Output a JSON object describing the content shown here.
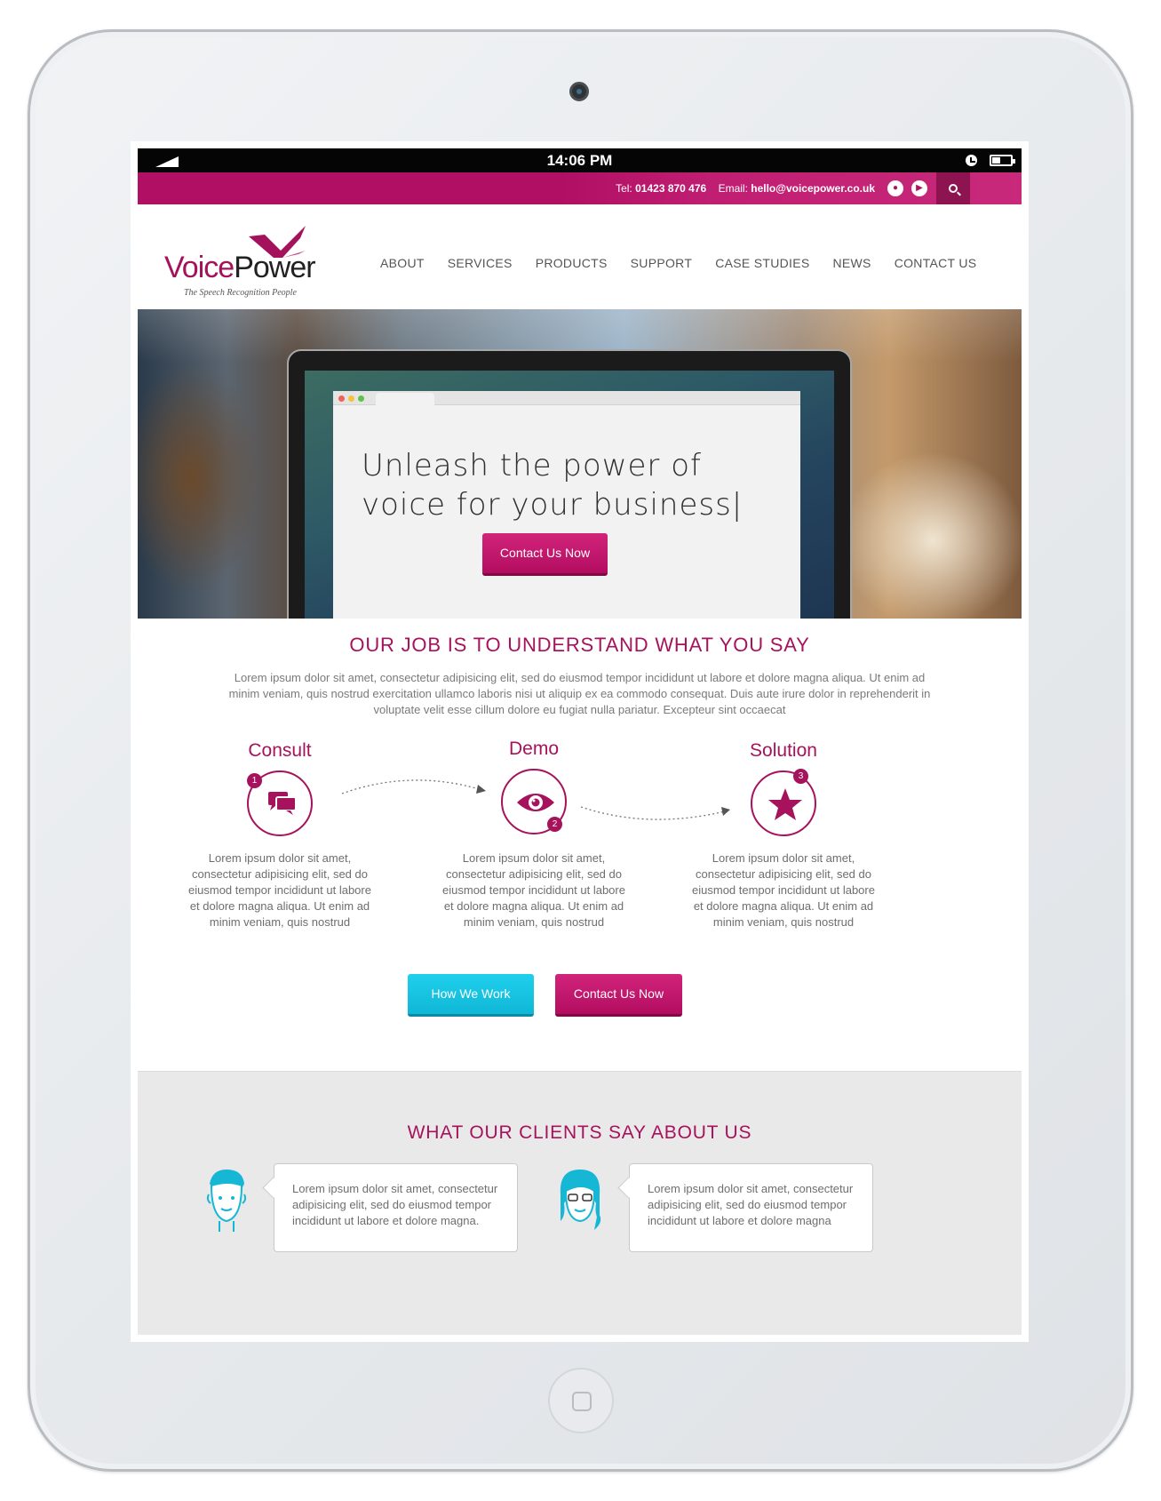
{
  "status_bar": {
    "time": "14:06 PM"
  },
  "top_bar": {
    "tel_label": "Tel:",
    "tel": "01423 870 476",
    "email_label": "Email:",
    "email": "hello@voicepower.co.uk"
  },
  "logo": {
    "brand_part1": "Voice",
    "brand_part2": "Power",
    "tagline": "The Speech Recognition People"
  },
  "nav": {
    "items": [
      "ABOUT",
      "SERVICES",
      "PRODUCTS",
      "SUPPORT",
      "CASE STUDIES",
      "NEWS",
      "CONTACT US"
    ]
  },
  "hero": {
    "title": "Unleash the power of voice for your business|",
    "button": "Contact Us Now"
  },
  "intro": {
    "title": "OUR JOB IS TO UNDERSTAND WHAT YOU SAY",
    "text": "Lorem ipsum dolor sit amet, consectetur adipisicing elit, sed do eiusmod tempor incididunt ut labore et dolore magna aliqua. Ut enim ad minim veniam, quis nostrud exercitation ullamco laboris nisi ut aliquip ex ea commodo consequat. Duis aute irure dolor in reprehenderit in voluptate velit esse cillum dolore eu fugiat nulla pariatur. Excepteur sint occaecat"
  },
  "steps": [
    {
      "title": "Consult",
      "number": "1",
      "icon": "chat-bubbles-icon",
      "text": "Lorem ipsum dolor sit amet, consectetur adipisicing elit, sed do eiusmod tempor incididunt ut labore et dolore magna aliqua. Ut enim ad minim veniam, quis nostrud"
    },
    {
      "title": "Demo",
      "number": "2",
      "icon": "eye-icon",
      "text": "Lorem ipsum dolor sit amet, consectetur adipisicing elit, sed do eiusmod tempor incididunt ut labore et dolore magna aliqua. Ut enim ad minim veniam, quis nostrud"
    },
    {
      "title": "Solution",
      "number": "3",
      "icon": "star-icon",
      "text": "Lorem ipsum dolor sit amet, consectetur adipisicing elit, sed do eiusmod tempor incididunt ut labore et dolore magna aliqua. Ut enim ad minim veniam, quis nostrud"
    }
  ],
  "actions": {
    "how_we_work": "How We Work",
    "contact": "Contact Us Now"
  },
  "clients": {
    "title": "WHAT OUR CLIENTS SAY ABOUT US",
    "quotes": [
      "Lorem ipsum dolor sit amet, consectetur adipisicing elit, sed do eiusmod tempor incididunt ut labore et dolore magna.",
      "Lorem ipsum dolor sit amet, consectetur adipisicing elit, sed do eiusmod tempor incididunt ut labore et dolore magna"
    ]
  },
  "colors": {
    "brand": "#a6125c",
    "accent_cyan": "#10b7d6"
  }
}
